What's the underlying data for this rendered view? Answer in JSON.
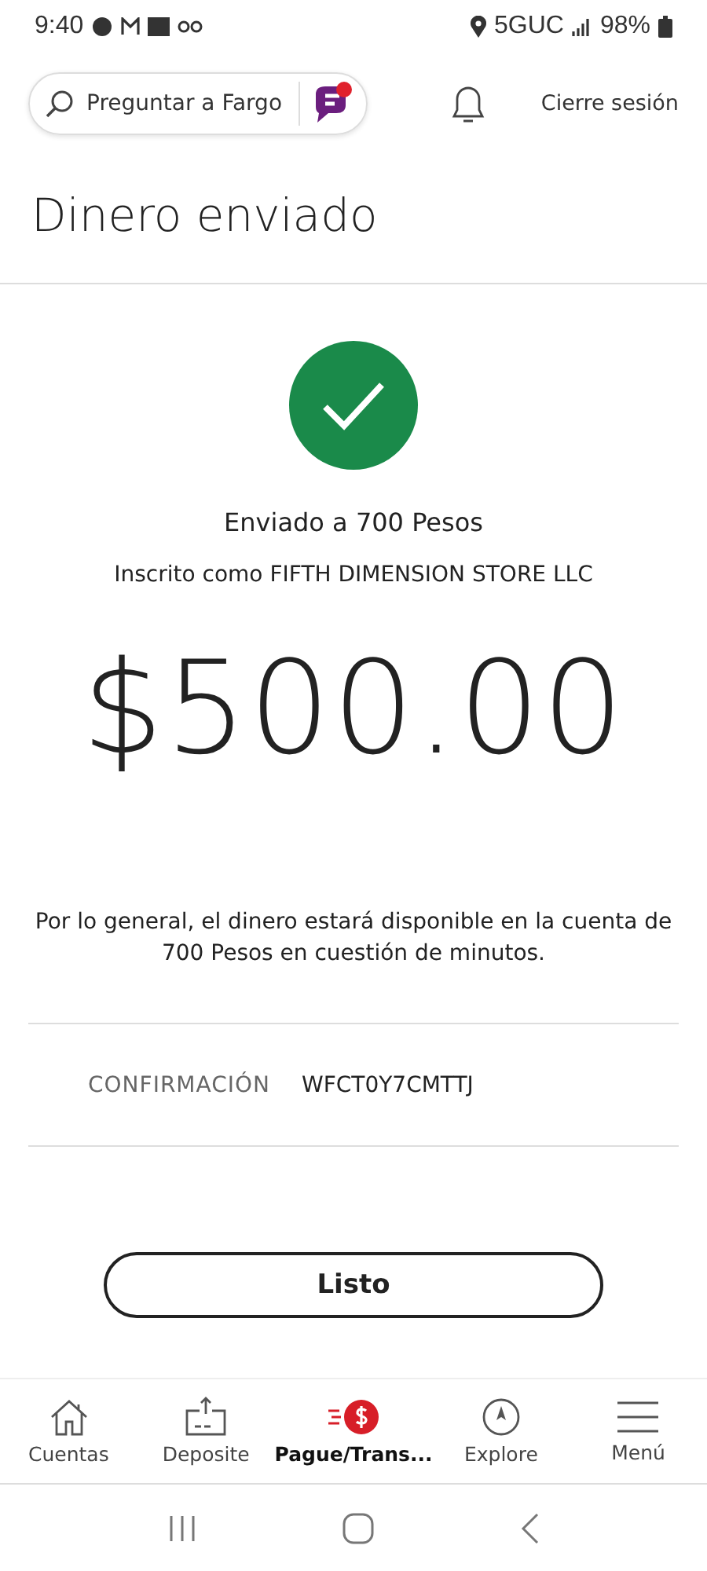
{
  "status_bar": {
    "time": "9:40",
    "network": "5GUC",
    "battery": "98%"
  },
  "header": {
    "search": {
      "placeholder": "Preguntar a Fargo"
    },
    "assistant_badge": true,
    "logout": "Cierre sesión"
  },
  "title": "Dinero enviado",
  "confirmation": {
    "sent_to": "Enviado a 700 Pesos",
    "enrolled_as": "Inscrito como FIFTH DIMENSION STORE LLC",
    "amount": "$500.00",
    "note": "Por lo general, el dinero estará disponible en la cuenta de 700 Pesos en cuestión de minutos.",
    "code_label": "CONFIRMACIÓN",
    "code": "WFCT0Y7CMTTJ"
  },
  "done_button": "Listo",
  "bottom_nav": [
    {
      "label": "Cuentas",
      "kind": "home",
      "selected": false
    },
    {
      "label": "Deposite",
      "kind": "deposit",
      "selected": false
    },
    {
      "label": "Pague/Trans...",
      "kind": "pay",
      "selected": true
    },
    {
      "label": "Explore",
      "kind": "compass",
      "selected": false
    },
    {
      "label": "Menú",
      "kind": "menu",
      "selected": false
    }
  ]
}
